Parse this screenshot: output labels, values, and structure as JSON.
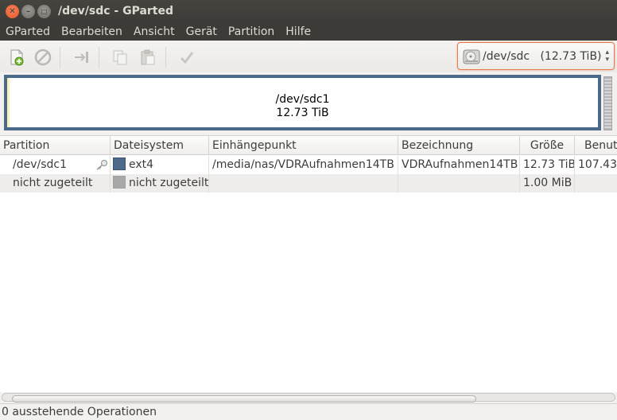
{
  "window": {
    "title": "/dev/sdc - GParted"
  },
  "menu": [
    "GParted",
    "Bearbeiten",
    "Ansicht",
    "Gerät",
    "Partition",
    "Hilfe"
  ],
  "toolbar": {
    "icons": [
      "new-partition-icon",
      "delete-icon",
      "resize-move-icon",
      "copy-icon",
      "paste-icon",
      "apply-icon"
    ]
  },
  "device_selector": {
    "label": "/dev/sdc   (12.73 TiB)"
  },
  "graph": {
    "partition_name": "/dev/sdc1",
    "partition_size": "12.73 TiB"
  },
  "table": {
    "headers": [
      "Partition",
      "Dateisystem",
      "Einhängepunkt",
      "Bezeichnung",
      "Größe",
      "Benut"
    ],
    "rows": [
      {
        "partition": "/dev/sdc1",
        "filesystem": "ext4",
        "fs_color": "#4b6a8a",
        "mountpoint": "/media/nas/VDRAufnahmen14TB",
        "label": "VDRAufnahmen14TB",
        "size": "12.73 TiB",
        "used": "107.43"
      },
      {
        "partition": "nicht zugeteilt",
        "filesystem": "nicht zugeteilt",
        "fs_color": "#a8a8a8",
        "mountpoint": "",
        "label": "",
        "size": "1.00 MiB",
        "used": ""
      }
    ]
  },
  "status": {
    "text": "0 ausstehende Operationen"
  },
  "colors": {
    "accent": "#e67a4f",
    "titlebar": "#3c3b37",
    "partition_border": "#4b6a8a"
  }
}
